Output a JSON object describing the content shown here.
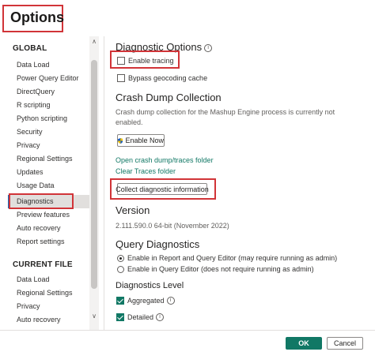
{
  "window": {
    "title": "Options"
  },
  "sidebar": {
    "global_heading": "GLOBAL",
    "global_items": [
      {
        "label": "Data Load"
      },
      {
        "label": "Power Query Editor"
      },
      {
        "label": "DirectQuery"
      },
      {
        "label": "R scripting"
      },
      {
        "label": "Python scripting"
      },
      {
        "label": "Security"
      },
      {
        "label": "Privacy"
      },
      {
        "label": "Regional Settings"
      },
      {
        "label": "Updates"
      },
      {
        "label": "Usage Data"
      },
      {
        "label": "Diagnostics",
        "selected": true
      },
      {
        "label": "Preview features"
      },
      {
        "label": "Auto recovery"
      },
      {
        "label": "Report settings"
      }
    ],
    "current_file_heading": "CURRENT FILE",
    "current_file_items": [
      {
        "label": "Data Load"
      },
      {
        "label": "Regional Settings"
      },
      {
        "label": "Privacy"
      },
      {
        "label": "Auto recovery"
      }
    ],
    "scroll_up_glyph": "∧",
    "scroll_down_glyph": "∨"
  },
  "main": {
    "diagnostic_options": {
      "heading": "Diagnostic Options",
      "info_glyph": "i",
      "enable_tracing": {
        "label": "Enable tracing",
        "checked": false
      },
      "bypass_geocoding": {
        "label": "Bypass geocoding cache",
        "checked": false
      }
    },
    "crash_dump": {
      "heading": "Crash Dump Collection",
      "description": "Crash dump collection for the Mashup Engine process is currently not enabled.",
      "enable_now_label": "Enable Now",
      "open_folder_link": "Open crash dump/traces folder",
      "clear_folder_link": "Clear Traces folder",
      "collect_label": "Collect diagnostic information"
    },
    "version": {
      "heading": "Version",
      "value": "2.111.590.0 64-bit (November 2022)"
    },
    "query_diagnostics": {
      "heading": "Query Diagnostics",
      "options": [
        {
          "label": "Enable in Report and Query Editor (may require running as admin)",
          "selected": true
        },
        {
          "label": "Enable in Query Editor (does not require running as admin)",
          "selected": false
        }
      ]
    },
    "diagnostics_level": {
      "heading": "Diagnostics Level",
      "aggregated": {
        "label": "Aggregated",
        "checked": true
      },
      "detailed": {
        "label": "Detailed",
        "checked": true
      }
    }
  },
  "footer": {
    "ok_label": "OK",
    "cancel_label": "Cancel"
  },
  "colors": {
    "accent": "#117865",
    "highlight": "#d13438",
    "selection_bar": "#0f6cbd"
  }
}
